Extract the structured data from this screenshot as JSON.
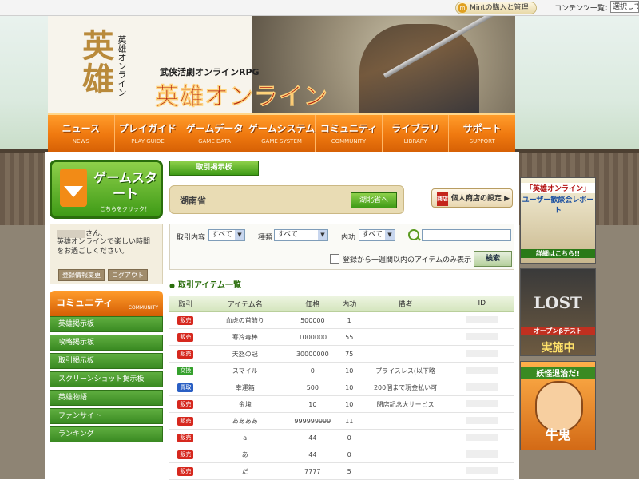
{
  "topbar": {
    "mint_label": "Mintの購入と管理",
    "content_list_label": "コンテンツ一覧：",
    "content_select_value": "選択してください"
  },
  "header": {
    "logo_kanji": "英雄",
    "logo_sub": "英雄オンライン",
    "tagline": "武侠活劇オンラインRPG",
    "title": "英雄オンライン"
  },
  "nav": [
    {
      "jp": "ニュース",
      "en": "NEWS"
    },
    {
      "jp": "プレイガイド",
      "en": "PLAY GUIDE"
    },
    {
      "jp": "ゲームデータ",
      "en": "GAME DATA"
    },
    {
      "jp": "ゲームシステム",
      "en": "GAME SYSTEM"
    },
    {
      "jp": "コミュニティ",
      "en": "COMMUNITY"
    },
    {
      "jp": "ライブラリ",
      "en": "LIBRARY"
    },
    {
      "jp": "サポート",
      "en": "SUPPORT"
    }
  ],
  "left": {
    "gamestart_title": "ゲームスタート",
    "gamestart_sub": "こちらをクリック！",
    "user_suffix": "さん、",
    "user_msg": "英雄オンラインで楽しい時間をお過ごしください。",
    "btn_edit": "登録情報変更",
    "btn_logout": "ログアウト",
    "community_jp": "コミュニティ",
    "community_en": "COMMUNITY",
    "menu": [
      "英雄掲示板",
      "攻略掲示板",
      "取引掲示板",
      "スクリーンショット掲示板",
      "英雄物語",
      "ファンサイト",
      "ランキング"
    ]
  },
  "center": {
    "board_tag": "取引掲示板",
    "province": "湖南省",
    "next_province": "湖北省へ",
    "shop_stamp": "商店",
    "shop_btn": "個人商店の設定 ▶",
    "filters": {
      "trade_label": "取引内容",
      "trade_value": "すべて",
      "type_label": "種類",
      "type_value": "すべて",
      "inner_label": "内功",
      "inner_value": "すべて",
      "check_label": "登録から一週間以内のアイテムのみ表示",
      "submit": "検索"
    },
    "list_title": "取引アイテム一覧",
    "columns": [
      "取引",
      "アイテム名",
      "価格",
      "内功",
      "備考",
      "ID"
    ],
    "rows": [
      {
        "type": "販売",
        "kind": "sell",
        "name": "血虎の首飾り",
        "price": "500000",
        "inner": "1",
        "note": ""
      },
      {
        "type": "販売",
        "kind": "sell",
        "name": "寒冷毒棒",
        "price": "1000000",
        "inner": "55",
        "note": ""
      },
      {
        "type": "販売",
        "kind": "sell",
        "name": "天怒の冠",
        "price": "30000000",
        "inner": "75",
        "note": ""
      },
      {
        "type": "交換",
        "kind": "trade",
        "name": "スマイル",
        "price": "0",
        "inner": "10",
        "note": "プライスレス(以下略"
      },
      {
        "type": "買取",
        "kind": "buy",
        "name": "幸運箱",
        "price": "500",
        "inner": "10",
        "note": "200個まで現金払い可"
      },
      {
        "type": "販売",
        "kind": "sell",
        "name": "金塊",
        "price": "10",
        "inner": "10",
        "note": "閉店記念大サービス"
      },
      {
        "type": "販売",
        "kind": "sell",
        "name": "ああああ",
        "price": "999999999",
        "inner": "11",
        "note": ""
      },
      {
        "type": "販売",
        "kind": "sell",
        "name": "a",
        "price": "44",
        "inner": "0",
        "note": ""
      },
      {
        "type": "販売",
        "kind": "sell",
        "name": "あ",
        "price": "44",
        "inner": "0",
        "note": ""
      },
      {
        "type": "販売",
        "kind": "sell",
        "name": "だ",
        "price": "7777",
        "inner": "5",
        "note": ""
      }
    ]
  },
  "banners": {
    "b1_title": "「英雄オンライン」",
    "b1_title2": "ユーザー歓談会レポート",
    "b1_small": "詳細はこちら!!",
    "b2_title": "LOST",
    "b2_sub": "オープンβテスト",
    "b2_main": "実施中",
    "b3_title": "妖怪退治だ!",
    "b3_main": "牛鬼"
  }
}
